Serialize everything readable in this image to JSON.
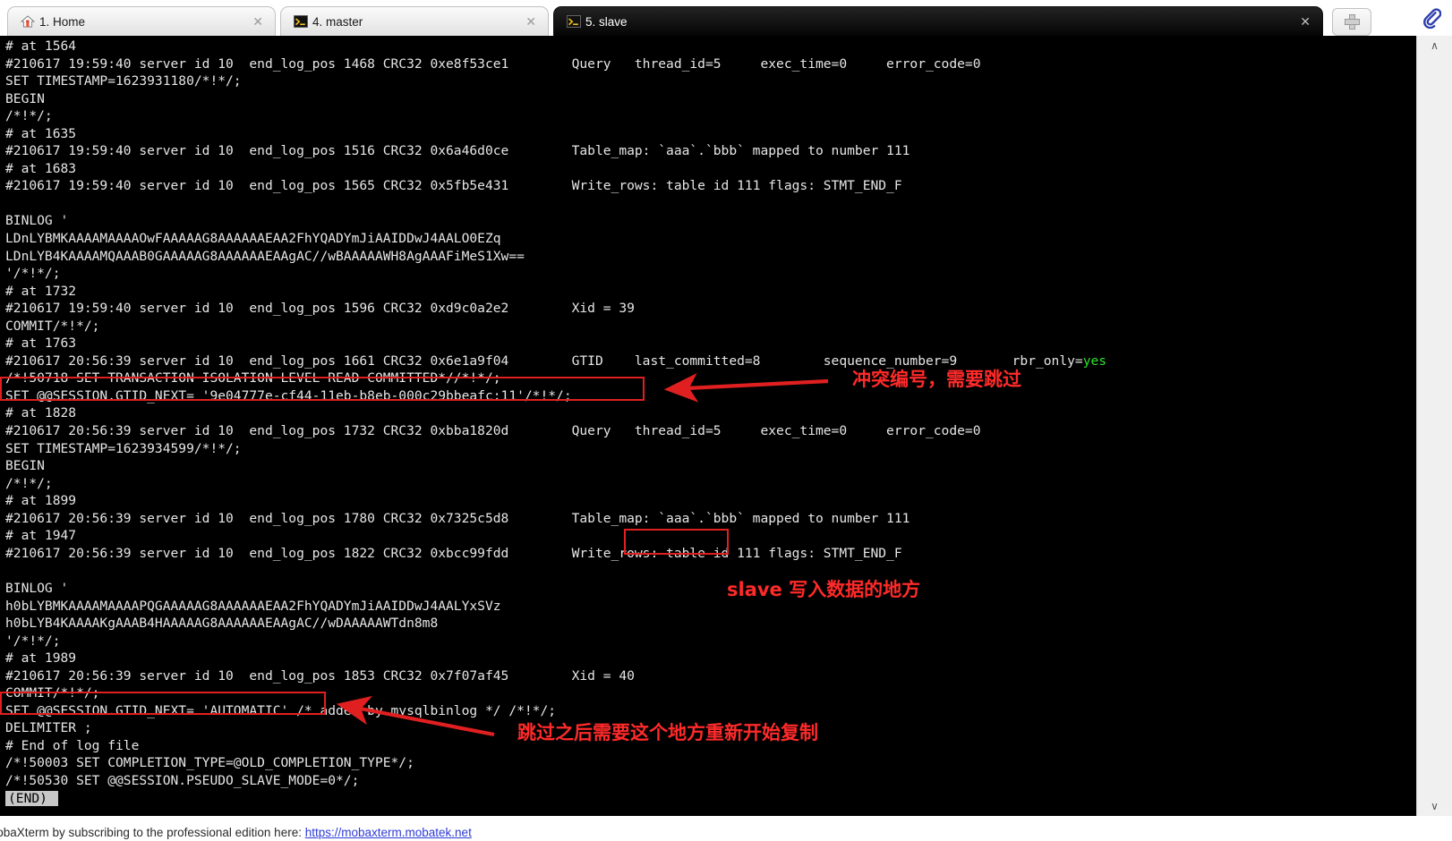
{
  "window": {
    "app_name": "MobaXterm",
    "attach_icon": "paperclip-icon"
  },
  "tabs": [
    {
      "label": "1. Home",
      "icon": "home-icon",
      "active": false,
      "close": "✕"
    },
    {
      "label": "4. master",
      "icon": "terminal-icon",
      "active": false,
      "close": "✕"
    },
    {
      "label": "5. slave",
      "icon": "terminal-icon",
      "active": true,
      "close": "✕"
    }
  ],
  "new_tab": {
    "label": "+",
    "icon": "plus-icon"
  },
  "terminal": {
    "lines": [
      "# at 1564",
      "#210617 19:59:40 server id 10  end_log_pos 1468 CRC32 0xe8f53ce1 \tQuery\tthread_id=5\texec_time=0\terror_code=0",
      "SET TIMESTAMP=1623931180/*!*/;",
      "BEGIN",
      "/*!*/;",
      "# at 1635",
      "#210617 19:59:40 server id 10  end_log_pos 1516 CRC32 0x6a46d0ce \tTable_map: `aaa`.`bbb` mapped to number 111",
      "# at 1683",
      "#210617 19:59:40 server id 10  end_log_pos 1565 CRC32 0x5fb5e431 \tWrite_rows: table id 111 flags: STMT_END_F",
      "",
      "BINLOG '",
      "LDnLYBMKAAAAMAAAAOwFAAAAAG8AAAAAAEAA2FhYQADYmJiAAIDDwJ4AALO0EZq",
      "LDnLYB4KAAAAMQAAAB0GAAAAAG8AAAAAAEAAgAC//wBAAAAAWH8AgAAAFiMeS1Xw==",
      "'/*!*/;",
      "# at 1732",
      "#210617 19:59:40 server id 10  end_log_pos 1596 CRC32 0xd9c0a2e2 \tXid = 39",
      "COMMIT/*!*/;",
      "# at 1763",
      "#210617 20:56:39 server id 10  end_log_pos 1661 CRC32 0x6e1a9f04 \tGTID\tlast_committed=8\tsequence_number=9\trbr_only=yes",
      "/*!50718 SET TRANSACTION ISOLATION LEVEL READ COMMITTED*//*!*/;",
      "SET @@SESSION.GTID_NEXT= '9e04777e-cf44-11eb-b8eb-000c29bbeafc:11'/*!*/;",
      "# at 1828",
      "#210617 20:56:39 server id 10  end_log_pos 1732 CRC32 0xbba1820d \tQuery\tthread_id=5\texec_time=0\terror_code=0",
      "SET TIMESTAMP=1623934599/*!*/;",
      "BEGIN",
      "/*!*/;",
      "# at 1899",
      "#210617 20:56:39 server id 10  end_log_pos 1780 CRC32 0x7325c5d8 \tTable_map: `aaa`.`bbb` mapped to number 111",
      "# at 1947",
      "#210617 20:56:39 server id 10  end_log_pos 1822 CRC32 0xbcc99fdd \tWrite_rows: table id 111 flags: STMT_END_F",
      "",
      "BINLOG '",
      "h0bLYBMKAAAAMAAAAPQGAAAAAG8AAAAAAEAA2FhYQADYmJiAAIDDwJ4AALYxSVz",
      "h0bLYB4KAAAAKgAAAB4HAAAAAG8AAAAAAEAAgAC//wDAAAAAWTdn8m8",
      "'/*!*/;",
      "# at 1989",
      "#210617 20:56:39 server id 10  end_log_pos 1853 CRC32 0x7f07af45 \tXid = 40",
      "COMMIT/*!*/;",
      "SET @@SESSION.GTID_NEXT= 'AUTOMATIC' /* added by mysqlbinlog */ /*!*/;",
      "DELIMITER ;",
      "# End of log file",
      "/*!50003 SET COMPLETION_TYPE=@OLD_COMPLETION_TYPE*/;",
      "/*!50530 SET @@SESSION.PSEUDO_SLAVE_MODE=0*/;"
    ],
    "pager_prompt": "(END)",
    "green_token": "yes"
  },
  "annotations": [
    {
      "id": "note-conflict-gtid",
      "text": "冲突编号，需要跳过",
      "color": "#ff2a2a"
    },
    {
      "id": "note-slave-write",
      "text": "slave 写入数据的地方",
      "color": "#ff2a2a"
    },
    {
      "id": "note-restart-repl",
      "text": "跳过之后需要这个地方重新开始复制",
      "color": "#ff2a2a"
    }
  ],
  "highlight_boxes": [
    {
      "id": "box-gtid-next-value",
      "target": "SET @@SESSION.GTID_NEXT= '9e04777e-cf44-11eb-b8eb-000c29bbeafc:11'/*!*/;"
    },
    {
      "id": "box-write-rows",
      "target": "Write_rows:"
    },
    {
      "id": "box-gtid-automatic",
      "target": "SET @@SESSION.GTID_NEXT= 'AUTOMATIC'"
    }
  ],
  "scrollbar": {
    "up_arrow": "∧",
    "down_arrow": "∨"
  },
  "statusbar": {
    "text_before_link": "port MobaXterm by subscribing to the professional edition here:",
    "link_text": "https://mobaxterm.mobatek.net"
  }
}
